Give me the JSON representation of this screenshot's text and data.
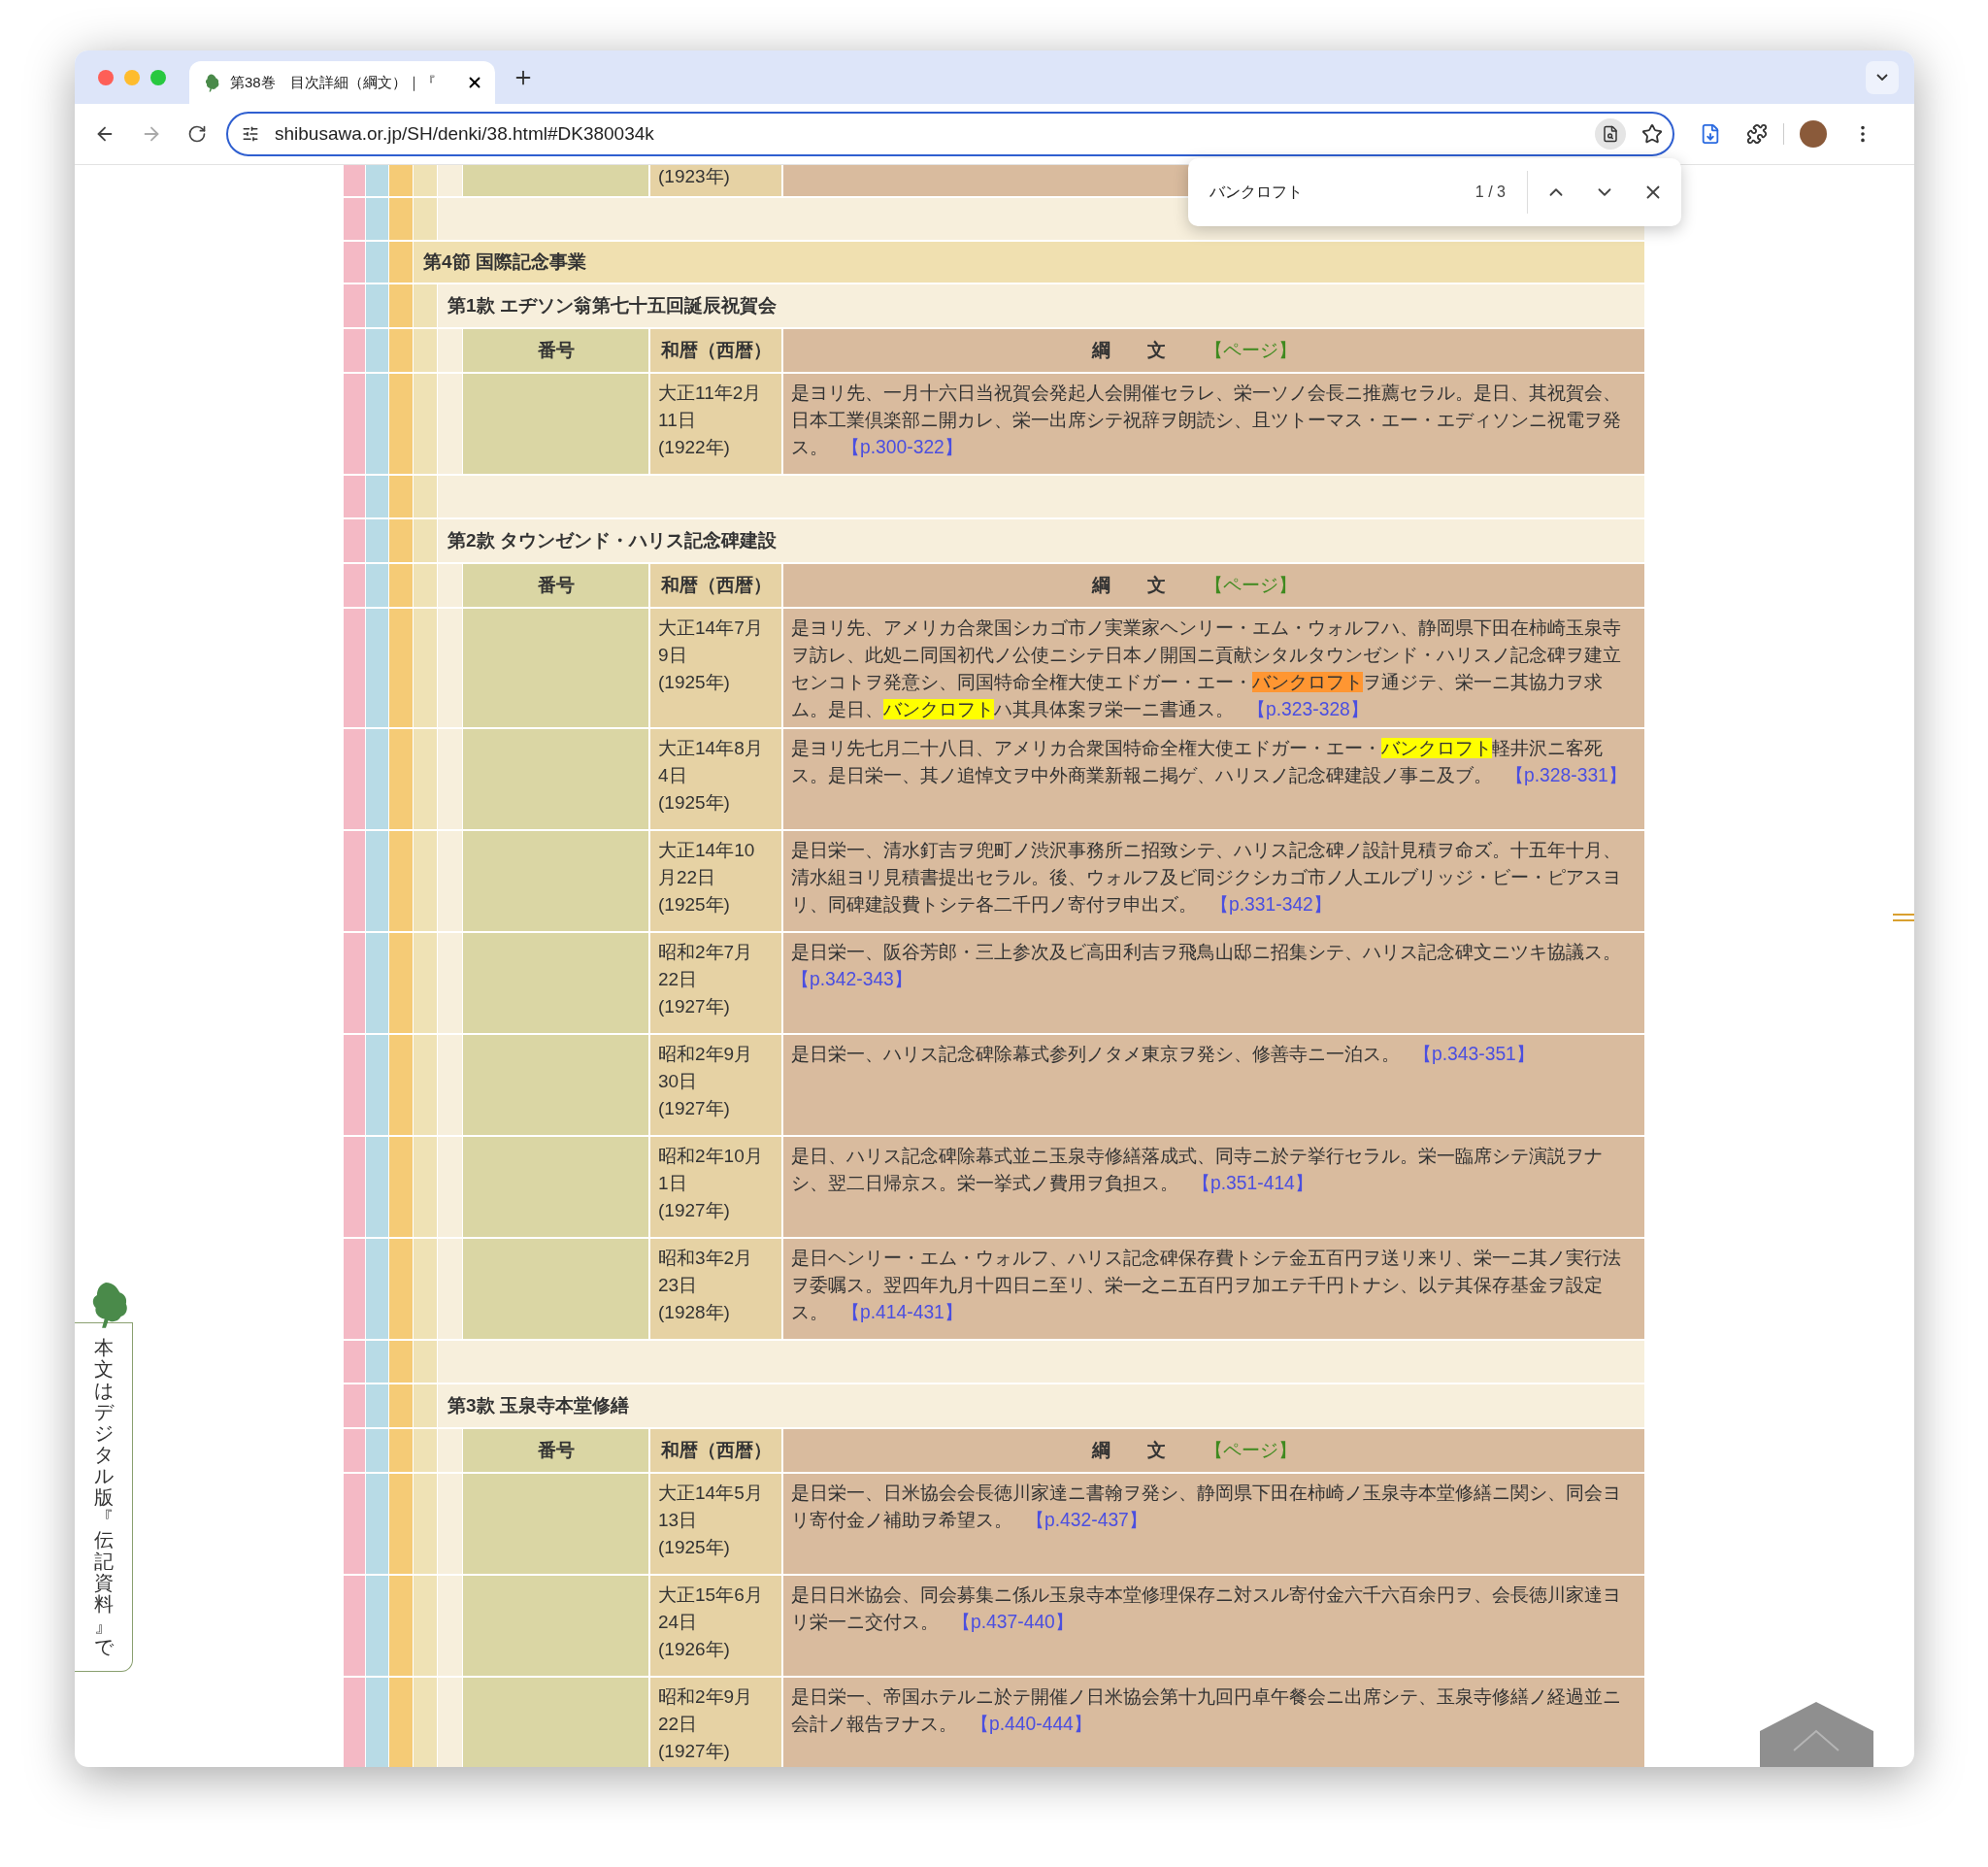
{
  "browser": {
    "tab": {
      "title": "第38巻　目次詳細（綱文）｜『",
      "selected": true
    },
    "url": "shibusawa.or.jp/SH/denki/38.html#DK380034k",
    "find_bar": {
      "query": "バンクロフト",
      "count": "1 / 3"
    }
  },
  "table": {
    "top_row": {
      "year": "(1923年)"
    },
    "blocks": [
      {
        "kind": "section",
        "title": "第4節 国際記念事業"
      },
      {
        "kind": "article",
        "title": "第1款 エヂソン翁第七十五回誕辰祝賀会",
        "header": {
          "number": "番号",
          "date": "和暦（西暦）",
          "summary": "綱　　文",
          "page": "【ページ】"
        },
        "rows": [
          {
            "date": "大正11年2月11日",
            "year": "(1922年)",
            "segments": [
              {
                "text": "是ヨリ先、一月十六日当祝賀会発起人会開催セラレ、栄一ソノ会長ニ推薦セラル。是日、其祝賀会、日本工業倶楽部ニ開カレ、栄一出席シテ祝辞ヲ朗読シ、且ツトーマス・エー・エディソンニ祝電ヲ発ス。",
                "found": false
              }
            ],
            "page": "【p.300-322】"
          }
        ]
      },
      {
        "kind": "article",
        "title": "第2款 タウンゼンド・ハリス記念碑建設",
        "header": {
          "number": "番号",
          "date": "和暦（西暦）",
          "summary": "綱　　文",
          "page": "【ページ】"
        },
        "rows": [
          {
            "date": "大正14年7月9日",
            "year": "(1925年)",
            "segments": [
              {
                "text": "是ヨリ先、アメリカ合衆国シカゴ市ノ実業家ヘンリー・エム・ウォルフハ、静岡県下田在柿崎玉泉寺ヲ訪レ、此処ニ同国初代ノ公使ニシテ日本ノ開国ニ貢献シタルタウンゼンド・ハリスノ記念碑ヲ建立センコトヲ発意シ、同国特命全権大使エドガー・エー・",
                "found": false
              },
              {
                "text": "バンクロフト",
                "found": true,
                "current": true
              },
              {
                "text": "ヲ通ジテ、栄一ニ其協力ヲ求ム。是日、",
                "found": false
              },
              {
                "text": "バンクロフト",
                "found": true,
                "current": false
              },
              {
                "text": "ハ其具体案ヲ栄一ニ書通ス。",
                "found": false
              }
            ],
            "page": "【p.323-328】"
          },
          {
            "date": "大正14年8月4日",
            "year": "(1925年)",
            "segments": [
              {
                "text": "是ヨリ先七月二十八日、アメリカ合衆国特命全権大使エドガー・エー・",
                "found": false
              },
              {
                "text": "バンクロフト",
                "found": true,
                "current": false
              },
              {
                "text": "軽井沢ニ客死ス。是日栄一、其ノ追悼文ヲ中外商業新報ニ掲ゲ、ハリスノ記念碑建設ノ事ニ及ブ。",
                "found": false
              }
            ],
            "page": "【p.328-331】"
          },
          {
            "date": "大正14年10月22日",
            "year": "(1925年)",
            "segments": [
              {
                "text": "是日栄一、清水釘吉ヲ兜町ノ渋沢事務所ニ招致シテ、ハリス記念碑ノ設計見積ヲ命ズ。十五年十月、清水組ヨリ見積書提出セラル。後、ウォルフ及ビ同ジクシカゴ市ノ人エルブリッジ・ビー・ピアスヨリ、同碑建設費トシテ各二千円ノ寄付ヲ申出ズ。",
                "found": false
              }
            ],
            "page": "【p.331-342】"
          },
          {
            "date": "昭和2年7月22日",
            "year": "(1927年)",
            "segments": [
              {
                "text": "是日栄一、阪谷芳郎・三上参次及ビ高田利吉ヲ飛鳥山邸ニ招集シテ、ハリス記念碑文ニツキ協議ス。",
                "found": false
              }
            ],
            "page": "【p.342-343】"
          },
          {
            "date": "昭和2年9月30日",
            "year": "(1927年)",
            "segments": [
              {
                "text": "是日栄一、ハリス記念碑除幕式参列ノタメ東京ヲ発シ、修善寺ニ一泊ス。",
                "found": false
              }
            ],
            "page": "【p.343-351】"
          },
          {
            "date": "昭和2年10月1日",
            "year": "(1927年)",
            "segments": [
              {
                "text": "是日、ハリス記念碑除幕式並ニ玉泉寺修繕落成式、同寺ニ於テ挙行セラル。栄一臨席シテ演説ヲナシ、翌二日帰京ス。栄一挙式ノ費用ヲ負担ス。",
                "found": false
              }
            ],
            "page": "【p.351-414】"
          },
          {
            "date": "昭和3年2月23日",
            "year": "(1928年)",
            "segments": [
              {
                "text": "是日ヘンリー・エム・ウォルフ、ハリス記念碑保存費トシテ金五百円ヲ送リ来リ、栄一ニ其ノ実行法ヲ委嘱ス。翌四年九月十四日ニ至リ、栄一之ニ五百円ヲ加エテ千円トナシ、以テ其保存基金ヲ設定ス。",
                "found": false
              }
            ],
            "page": "【p.414-431】"
          }
        ]
      },
      {
        "kind": "article",
        "title": "第3款 玉泉寺本堂修繕",
        "header": {
          "number": "番号",
          "date": "和暦（西暦）",
          "summary": "綱　　文",
          "page": "【ページ】"
        },
        "rows": [
          {
            "date": "大正14年5月13日",
            "year": "(1925年)",
            "segments": [
              {
                "text": "是日栄一、日米協会会長徳川家達ニ書翰ヲ発シ、静岡県下田在柿崎ノ玉泉寺本堂修繕ニ関シ、同会ヨリ寄付金ノ補助ヲ希望ス。",
                "found": false
              }
            ],
            "page": "【p.432-437】"
          },
          {
            "date": "大正15年6月24日",
            "year": "(1926年)",
            "segments": [
              {
                "text": "是日日米協会、同会募集ニ係ル玉泉寺本堂修理保存ニ対スル寄付金六千六百余円ヲ、会長徳川家達ヨリ栄一ニ交付ス。",
                "found": false
              }
            ],
            "page": "【p.437-440】"
          },
          {
            "date": "昭和2年9月22日",
            "year": "(1927年)",
            "segments": [
              {
                "text": "是日栄一、帝国ホテルニ於テ開催ノ日米協会第十九回円卓午餐会ニ出席シテ、玉泉寺修繕ノ経過並ニ会計ノ報告ヲナス。",
                "found": false
              }
            ],
            "page": "【p.440-444】"
          }
        ]
      }
    ]
  },
  "side_tab": {
    "text": "本文はデジタル版『伝記資料』で"
  }
}
